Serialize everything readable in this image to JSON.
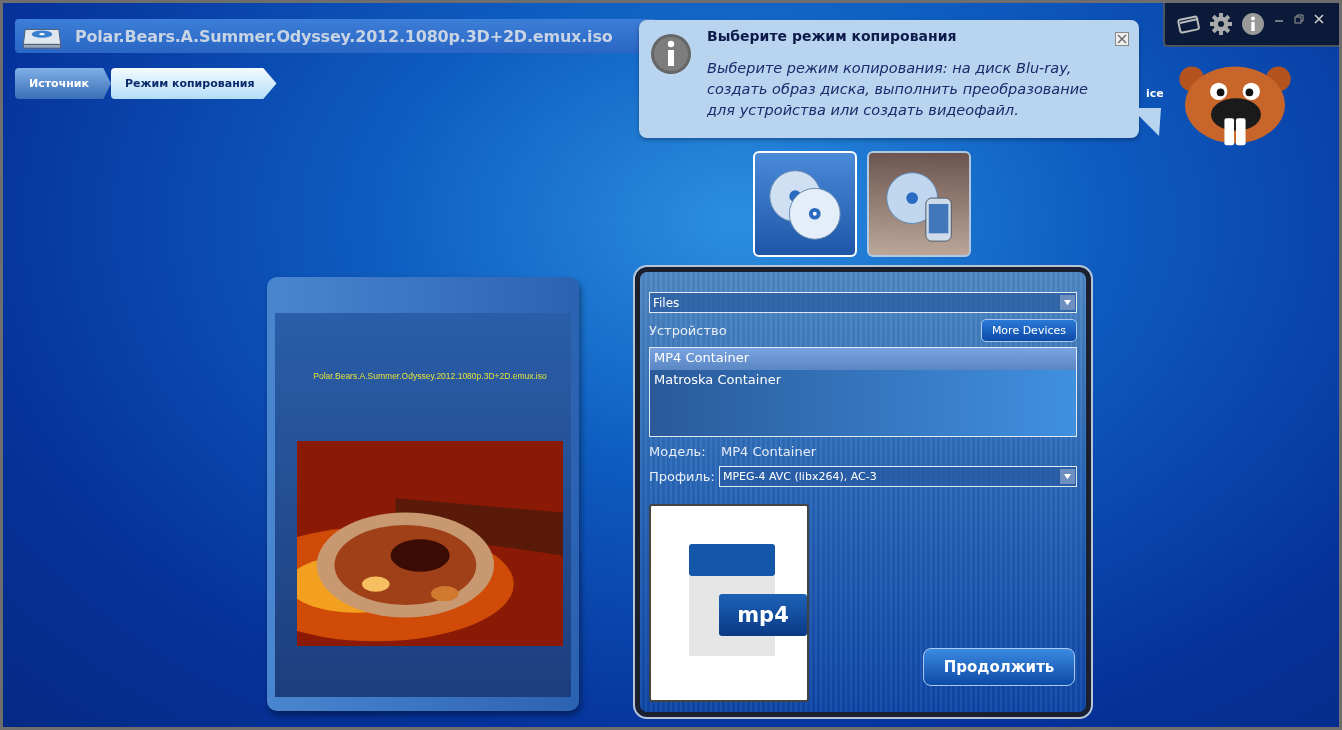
{
  "title_bar": {
    "title": "Polar.Bears.A.Summer.Odyssey.2012.1080p.3D+2D.emux.iso"
  },
  "breadcrumbs": [
    {
      "label": "Источник",
      "selected": false
    },
    {
      "label": "Режим копирования",
      "selected": true
    }
  ],
  "tooltip": {
    "title": "Выберите режим копирования",
    "text": "Выберите режим копирования: на диск Blu-ray, создать образ диска, выполнить преобразование для устройства или создать видеофайл."
  },
  "logo_fragment": "ice",
  "copy_modes": [
    {
      "kind": "disc",
      "selected": true
    },
    {
      "kind": "device",
      "selected": false
    }
  ],
  "cover": {
    "title": "Polar.Bears.A.Summer.Odyssey.2012.1080p.3D+2D.emux.iso"
  },
  "panel": {
    "category": "Files",
    "device_label": "Устройство",
    "more_devices": "More Devices",
    "devices": [
      {
        "name": "MP4 Container",
        "selected": true
      },
      {
        "name": "Matroska Container",
        "selected": false
      }
    ],
    "model_label": "Модель:",
    "model": "MP4 Container",
    "profile_label": "Профиль:",
    "profile": "MPEG-4 AVC (libx264), AC-3",
    "format_badge": "mp4",
    "continue": "Продолжить"
  }
}
